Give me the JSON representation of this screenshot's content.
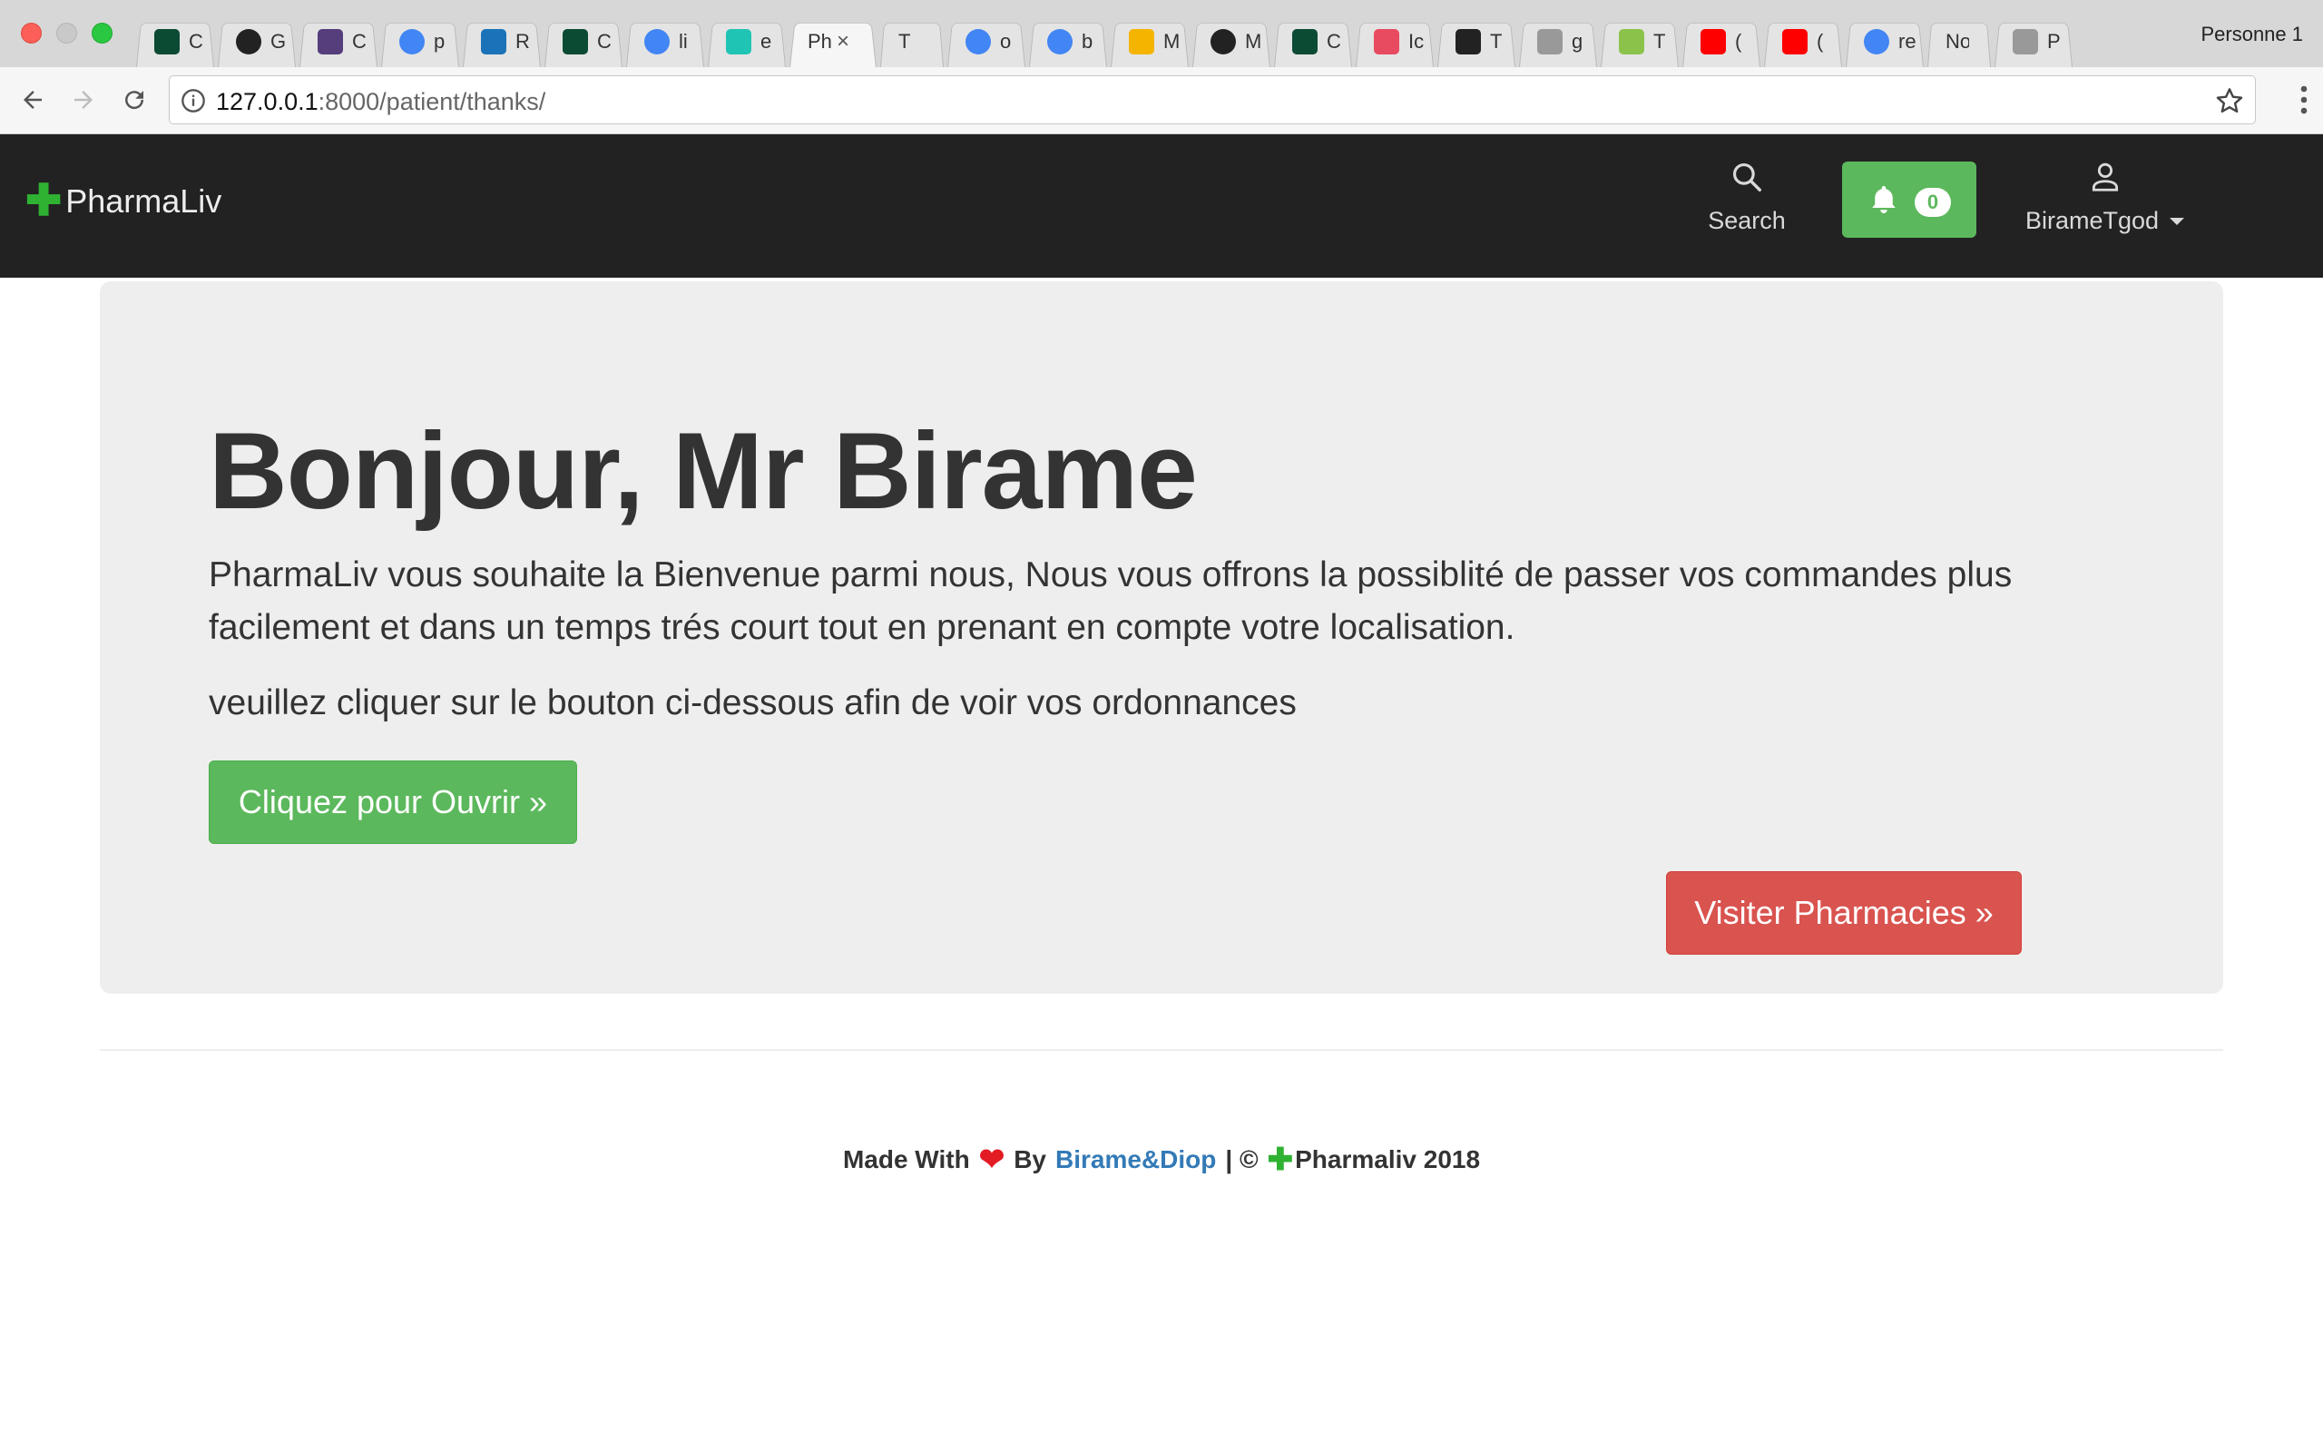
{
  "browser": {
    "profile": "Personne 1",
    "url_host": "127.0.0.1",
    "url_path": ":8000/patient/thanks/",
    "tabs": [
      {
        "icon": "django-icon",
        "title": "C",
        "color": "#0c4b33"
      },
      {
        "icon": "github-icon",
        "title": "G",
        "color": "#222222"
      },
      {
        "icon": "bootstrap-icon",
        "title": "C",
        "color": "#563d7c"
      },
      {
        "icon": "google-icon",
        "title": "p",
        "color": "#4285f4"
      },
      {
        "icon": "video-icon",
        "title": "R",
        "color": "#1a73b8"
      },
      {
        "icon": "django-icon",
        "title": "C",
        "color": "#0c4b33"
      },
      {
        "icon": "google-icon",
        "title": "li",
        "color": "#4285f4"
      },
      {
        "icon": "m-icon",
        "title": "e",
        "color": "#20c4b4"
      },
      {
        "icon": "none",
        "title": "Ph",
        "active": true
      },
      {
        "icon": "none",
        "title": "T"
      },
      {
        "icon": "google-icon",
        "title": "o",
        "color": "#4285f4"
      },
      {
        "icon": "google-icon",
        "title": "b",
        "color": "#4285f4"
      },
      {
        "icon": "drive-icon",
        "title": "M",
        "color": "#f4b400"
      },
      {
        "icon": "github-icon",
        "title": "M",
        "color": "#222222"
      },
      {
        "icon": "django-icon",
        "title": "C",
        "color": "#0c4b33"
      },
      {
        "icon": "lines-icon",
        "title": "Ic",
        "color": "#e84a5f"
      },
      {
        "icon": "v-icon",
        "title": "T",
        "color": "#222222"
      },
      {
        "icon": "doc-icon",
        "title": "g",
        "color": "#999999"
      },
      {
        "icon": "w3-icon",
        "title": "T",
        "color": "#8bc34a"
      },
      {
        "icon": "youtube-icon",
        "title": "(",
        "color": "#ff0000"
      },
      {
        "icon": "youtube-icon",
        "title": "(",
        "color": "#ff0000"
      },
      {
        "icon": "google-icon",
        "title": "re",
        "color": "#4285f4"
      },
      {
        "icon": "none",
        "title": "Nouv"
      },
      {
        "icon": "doc-icon",
        "title": "P",
        "color": "#999999"
      }
    ]
  },
  "navbar": {
    "brand": "PharmaLiv",
    "search_label": "Search",
    "notification_count": "0",
    "user_label": "BirameTgod"
  },
  "jumbotron": {
    "greeting": "Bonjour, Mr Birame",
    "lead": "PharmaLiv vous souhaite la Bienvenue parmi nous, Nous vous offrons la possiblité de passer vos commandes plus facilement et dans un temps trés court tout en prenant en compte votre localisation.",
    "prompt": "veuillez cliquer sur le bouton ci-dessous afin de voir vos ordonnances",
    "open_button": "Cliquez pour Ouvrir »",
    "visit_button": "Visiter Pharmacies »"
  },
  "footer": {
    "made_with": "Made With",
    "by": "By",
    "authors": "Birame&Diop",
    "separator": "| ©",
    "brand_year": "Pharmaliv 2018"
  },
  "colors": {
    "navbar_bg": "#222222",
    "success": "#5cb85c",
    "danger": "#d9534f",
    "link": "#337ab7",
    "brand_cross": "#2fb232"
  }
}
